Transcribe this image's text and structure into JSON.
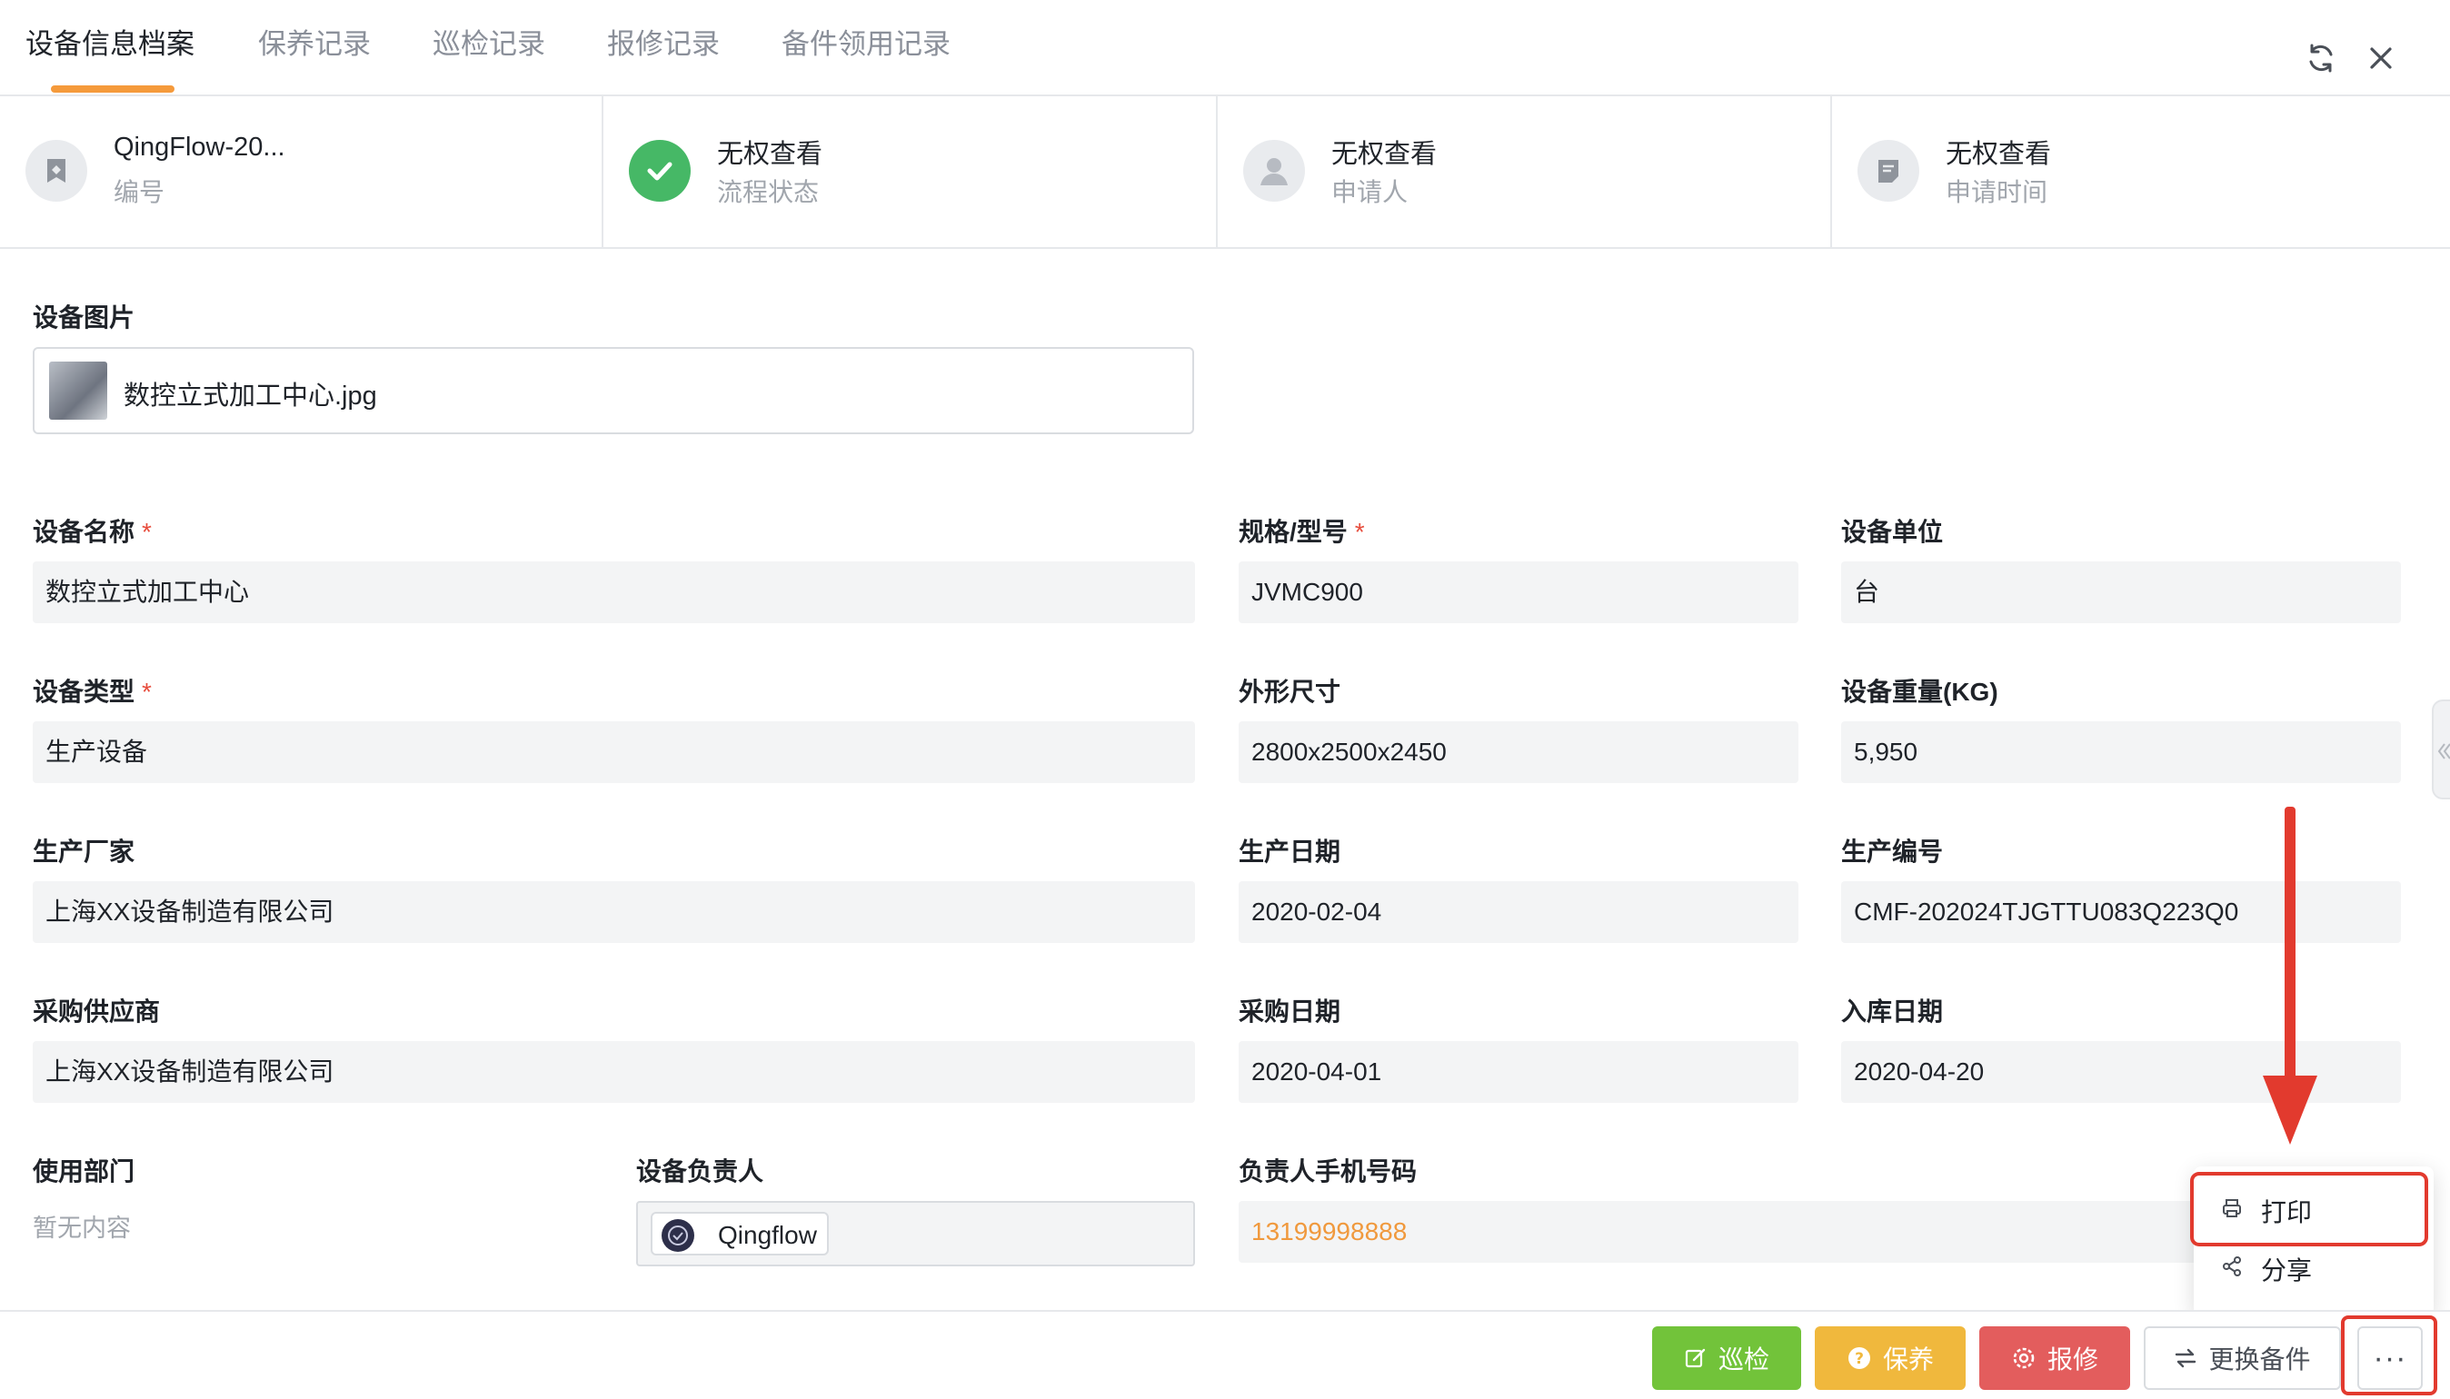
{
  "tabs": [
    {
      "label": "设备信息档案",
      "active": true
    },
    {
      "label": "保养记录",
      "active": false
    },
    {
      "label": "巡检记录",
      "active": false
    },
    {
      "label": "报修记录",
      "active": false
    },
    {
      "label": "备件领用记录",
      "active": false
    }
  ],
  "header_icons": [
    "refresh-icon",
    "close-icon"
  ],
  "info_cards": [
    {
      "value": "QingFlow-20...",
      "label": "编号",
      "icon": "id-tag-icon"
    },
    {
      "value": "无权查看",
      "label": "流程状态",
      "icon": "check-circle-icon"
    },
    {
      "value": "无权查看",
      "label": "申请人",
      "icon": "user-icon"
    },
    {
      "value": "无权查看",
      "label": "申请时间",
      "icon": "calendar-note-icon"
    }
  ],
  "form": {
    "device_image": {
      "label": "设备图片",
      "file_name": "数控立式加工中心.jpg"
    },
    "device_name": {
      "label": "设备名称",
      "required": true,
      "value": "数控立式加工中心"
    },
    "model": {
      "label": "规格/型号",
      "required": true,
      "value": "JVMC900"
    },
    "unit": {
      "label": "设备单位",
      "value": "台"
    },
    "device_type": {
      "label": "设备类型",
      "required": true,
      "value": "生产设备"
    },
    "dimensions": {
      "label": "外形尺寸",
      "value": "2800x2500x2450"
    },
    "weight": {
      "label": "设备重量(KG)",
      "value": "5,950"
    },
    "manufacturer": {
      "label": "生产厂家",
      "value": "上海XX设备制造有限公司"
    },
    "production_date": {
      "label": "生产日期",
      "value": "2020-02-04"
    },
    "serial_no": {
      "label": "生产编号",
      "value": "CMF-202024TJGTTU083Q223Q0"
    },
    "supplier": {
      "label": "采购供应商",
      "value": "上海XX设备制造有限公司"
    },
    "purchase_date": {
      "label": "采购日期",
      "value": "2020-04-01"
    },
    "storage_date": {
      "label": "入库日期",
      "value": "2020-04-20"
    },
    "department": {
      "label": "使用部门",
      "empty_text": "暂无内容"
    },
    "owner": {
      "label": "设备负责人",
      "value": "Qingflow"
    },
    "owner_phone": {
      "label": "负责人手机号码",
      "value": "13199998888"
    }
  },
  "required_mark": "*",
  "actions": {
    "inspect": "巡检",
    "maintain": "保养",
    "repair": "报修",
    "replace_parts": "更换备件",
    "more": "···"
  },
  "more_menu": [
    {
      "label": "打印",
      "icon": "printer-icon"
    },
    {
      "label": "分享",
      "icon": "share-icon"
    }
  ],
  "colors": {
    "accent": "#f59a3b",
    "inspect": "#72c33a",
    "maintain": "#f0b83d",
    "repair": "#e35d5d",
    "annotation": "#e23a2e",
    "phone": "#f0993d"
  }
}
